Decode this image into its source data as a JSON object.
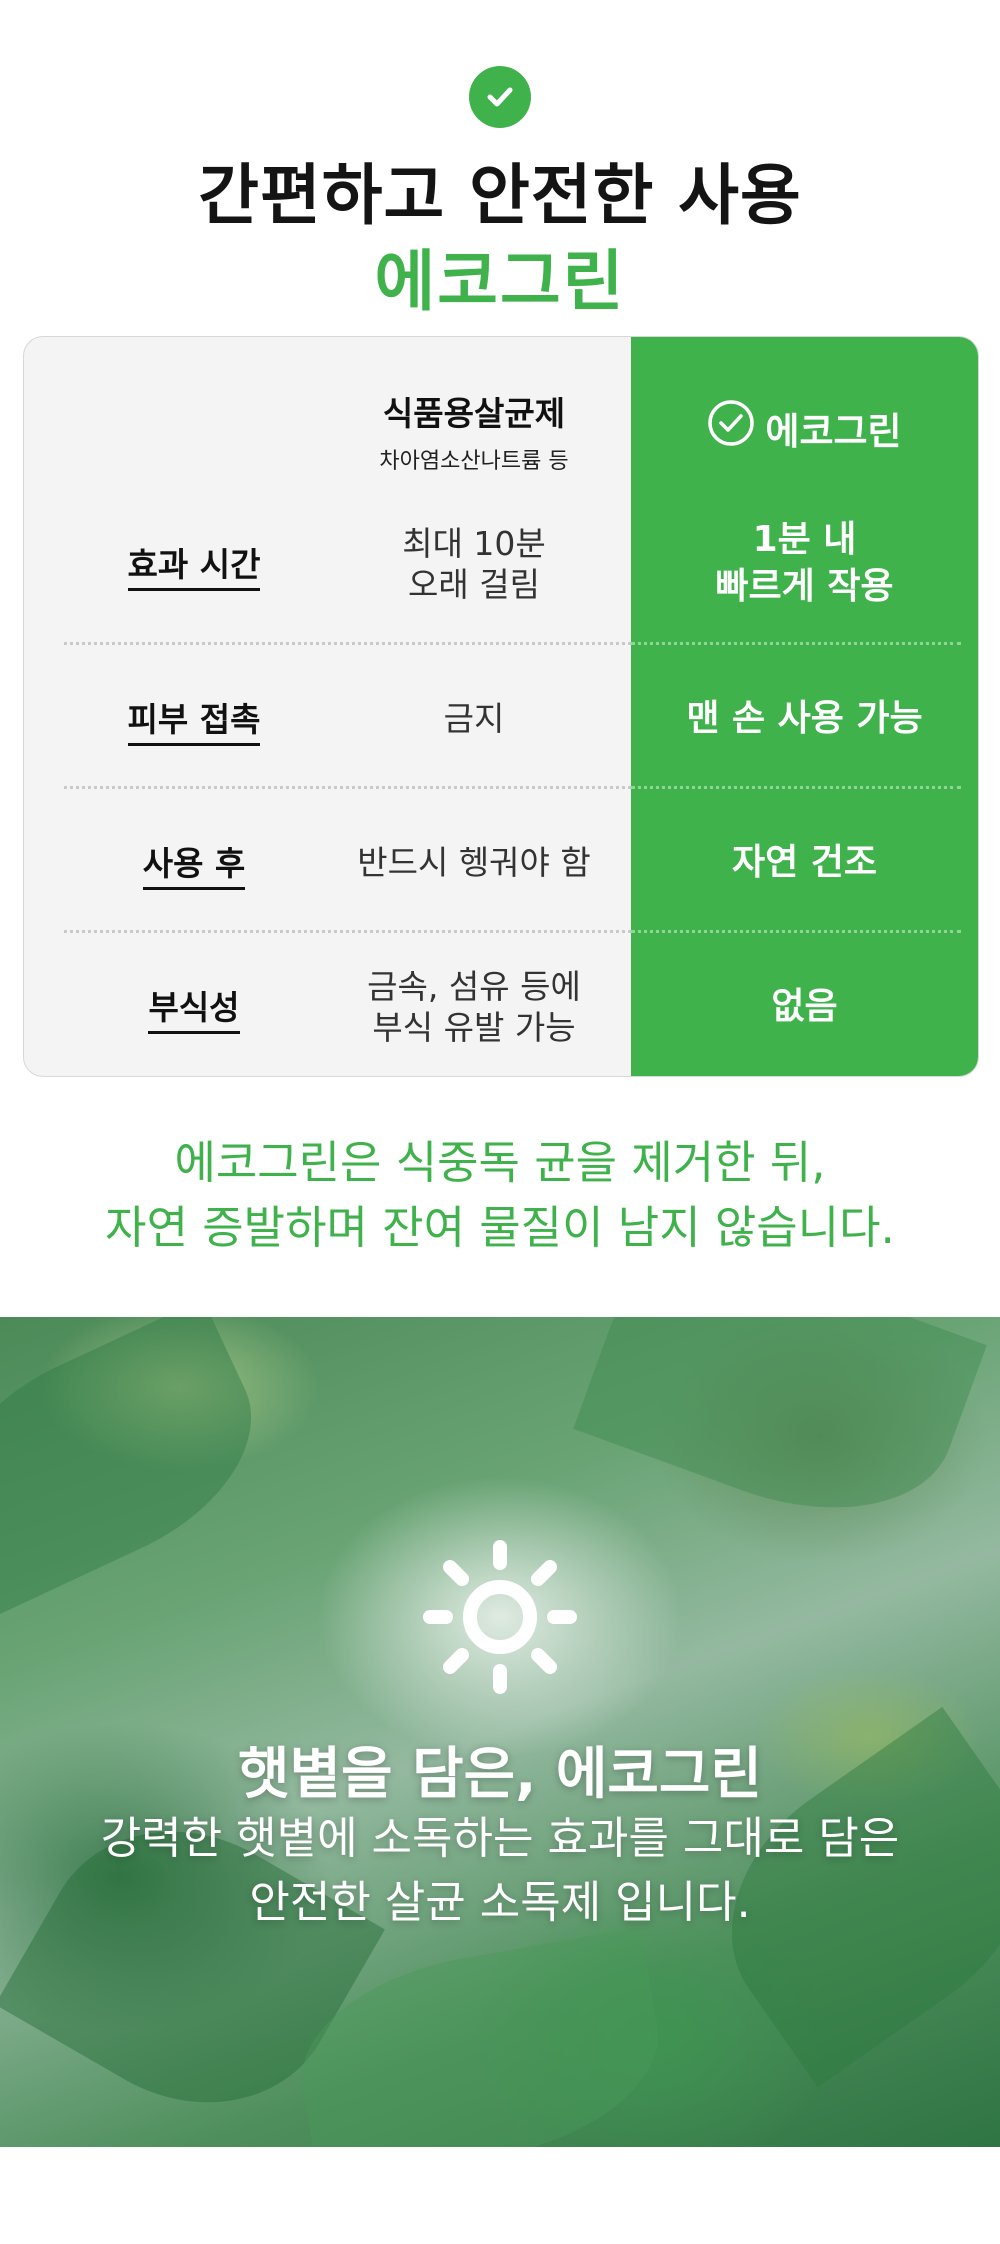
{
  "header": {
    "title": "간편하고 안전한 사용",
    "brand": "에코그린"
  },
  "comparison": {
    "left_header": {
      "title": "식품용살균제",
      "subtitle": "차아염소산나트륨 등"
    },
    "right_header": {
      "title": "에코그린"
    },
    "rows": [
      {
        "label": "효과 시간",
        "left": [
          "최대 10분",
          "오래 걸림"
        ],
        "right": [
          "1분 내",
          "빠르게 작용"
        ]
      },
      {
        "label": "피부 접촉",
        "left": [
          "금지"
        ],
        "right": [
          "맨 손 사용 가능"
        ]
      },
      {
        "label": "사용 후",
        "left": [
          "반드시 헹궈야 함"
        ],
        "right": [
          "자연 건조"
        ]
      },
      {
        "label": "부식성",
        "left": [
          "금속, 섬유 등에",
          "부식 유발 가능"
        ],
        "right": [
          "없음"
        ]
      }
    ]
  },
  "summary": {
    "line1": "에코그린은 식중독 균을 제거한 뒤,",
    "line2": "자연 증발하며 잔여 물질이 남지 않습니다."
  },
  "sunlight_section": {
    "title": "햇볕을 담은, 에코그린",
    "line1": "강력한 햇볕에 소독하는 효과를 그대로 담은",
    "line2": "안전한 살균 소독제 입니다."
  },
  "colors": {
    "accent": "#3fb24c",
    "table_bg": "#f4f4f4"
  },
  "icons": {
    "badge": "check-circle-icon",
    "sun": "sun-icon"
  }
}
